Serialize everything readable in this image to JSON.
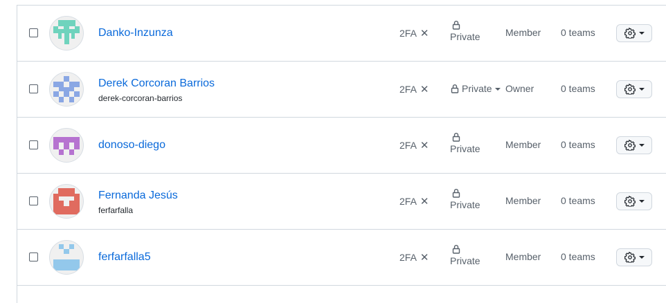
{
  "members": [
    {
      "name": "Danko-Inzunza",
      "login": "",
      "twofa": "2FA",
      "visibility": "Private",
      "role": "Member",
      "teams": "0 teams",
      "avatar_color": "#6fd3bd"
    },
    {
      "name": "Derek Corcoran Barrios",
      "login": "derek-corcoran-barrios",
      "twofa": "2FA",
      "visibility": "Private",
      "role": "Owner",
      "teams": "0 teams",
      "avatar_color": "#8aa7e4"
    },
    {
      "name": "donoso-diego",
      "login": "",
      "twofa": "2FA",
      "visibility": "Private",
      "role": "Member",
      "teams": "0 teams",
      "avatar_color": "#b673d0"
    },
    {
      "name": "Fernanda Jesús",
      "login": "ferfarfalla",
      "twofa": "2FA",
      "visibility": "Private",
      "role": "Member",
      "teams": "0 teams",
      "avatar_color": "#e06b5f"
    },
    {
      "name": "ferfarfalla5",
      "login": "",
      "twofa": "2FA",
      "visibility": "Private",
      "role": "Member",
      "teams": "0 teams",
      "avatar_color": "#93c8eb"
    }
  ],
  "icons": {
    "twofa_status": "x-icon",
    "visibility": "lock-icon",
    "row_action": "gear-icon",
    "dropdown": "triangle-down-icon"
  }
}
